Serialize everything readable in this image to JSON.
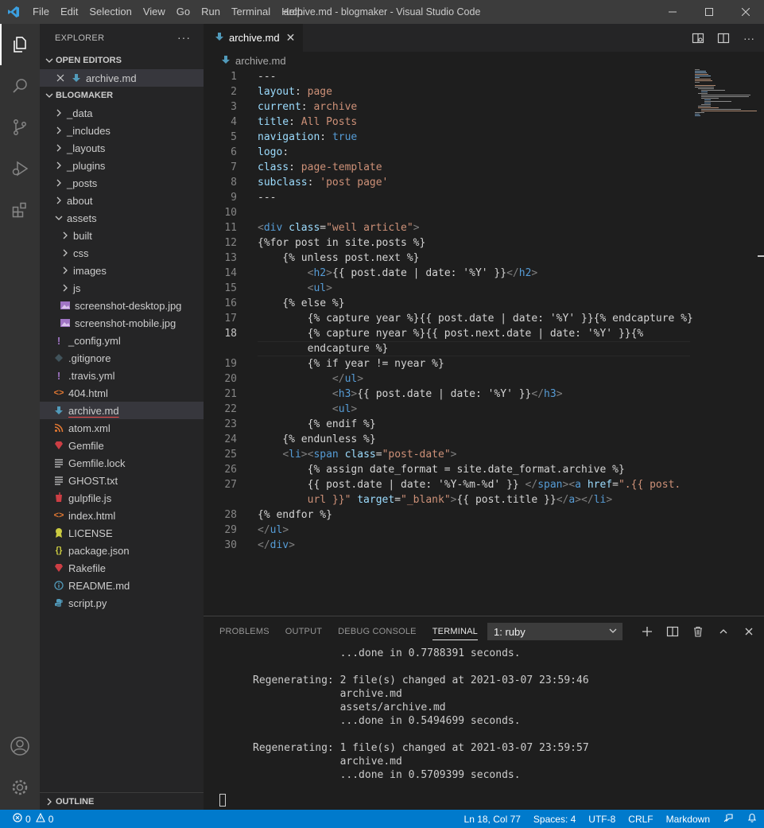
{
  "window": {
    "title": "archive.md - blogmaker - Visual Studio Code",
    "menu": [
      "File",
      "Edit",
      "Selection",
      "View",
      "Go",
      "Run",
      "Terminal",
      "Help"
    ]
  },
  "sidebar": {
    "header": "EXPLORER",
    "open_editors_label": "OPEN EDITORS",
    "open_editors": [
      {
        "name": "archive.md"
      }
    ],
    "project_label": "BLOGMAKER",
    "outline_label": "OUTLINE",
    "tree": [
      {
        "name": "_data",
        "type": "folder",
        "depth": 0
      },
      {
        "name": "_includes",
        "type": "folder",
        "depth": 0
      },
      {
        "name": "_layouts",
        "type": "folder",
        "depth": 0
      },
      {
        "name": "_plugins",
        "type": "folder",
        "depth": 0
      },
      {
        "name": "_posts",
        "type": "folder",
        "depth": 0
      },
      {
        "name": "about",
        "type": "folder",
        "depth": 0
      },
      {
        "name": "assets",
        "type": "folder-open",
        "depth": 0
      },
      {
        "name": "built",
        "type": "folder",
        "depth": 1
      },
      {
        "name": "css",
        "type": "folder",
        "depth": 1
      },
      {
        "name": "images",
        "type": "folder",
        "depth": 1
      },
      {
        "name": "js",
        "type": "folder",
        "depth": 1
      },
      {
        "name": "screenshot-desktop.jpg",
        "type": "image",
        "depth": 1
      },
      {
        "name": "screenshot-mobile.jpg",
        "type": "image",
        "depth": 1
      },
      {
        "name": "_config.yml",
        "type": "yaml",
        "depth": 0
      },
      {
        "name": ".gitignore",
        "type": "git",
        "depth": 0
      },
      {
        "name": ".travis.yml",
        "type": "yaml",
        "depth": 0
      },
      {
        "name": "404.html",
        "type": "html",
        "depth": 0
      },
      {
        "name": "archive.md",
        "type": "markdown",
        "depth": 0
      },
      {
        "name": "atom.xml",
        "type": "rss",
        "depth": 0
      },
      {
        "name": "Gemfile",
        "type": "ruby",
        "depth": 0
      },
      {
        "name": "Gemfile.lock",
        "type": "lines",
        "depth": 0
      },
      {
        "name": "GHOST.txt",
        "type": "lines",
        "depth": 0
      },
      {
        "name": "gulpfile.js",
        "type": "gulp",
        "depth": 0
      },
      {
        "name": "index.html",
        "type": "html",
        "depth": 0
      },
      {
        "name": "LICENSE",
        "type": "license",
        "depth": 0
      },
      {
        "name": "package.json",
        "type": "json",
        "depth": 0
      },
      {
        "name": "Rakefile",
        "type": "ruby",
        "depth": 0
      },
      {
        "name": "README.md",
        "type": "info",
        "depth": 0
      },
      {
        "name": "script.py",
        "type": "python",
        "depth": 0
      }
    ]
  },
  "editor": {
    "tab_label": "archive.md",
    "breadcrumb": "archive.md",
    "lines": [
      {
        "n": "1",
        "html": "<span class=\"p\">---</span>"
      },
      {
        "n": "2",
        "html": "<span class=\"a\">layout</span><span class=\"p\">: </span><span class=\"s\">page</span>"
      },
      {
        "n": "3",
        "html": "<span class=\"a\">current</span><span class=\"p\">: </span><span class=\"s\">archive</span>"
      },
      {
        "n": "4",
        "html": "<span class=\"a\">title</span><span class=\"p\">: </span><span class=\"s\">All Posts</span>"
      },
      {
        "n": "5",
        "html": "<span class=\"a\">navigation</span><span class=\"p\">: </span><span class=\"k\">true</span>"
      },
      {
        "n": "6",
        "html": "<span class=\"a\">logo</span><span class=\"p\">:</span>"
      },
      {
        "n": "7",
        "html": "<span class=\"a\">class</span><span class=\"p\">: </span><span class=\"s\">page-template</span>"
      },
      {
        "n": "8",
        "html": "<span class=\"a\">subclass</span><span class=\"p\">: </span><span class=\"s\">'post page'</span>"
      },
      {
        "n": "9",
        "html": "<span class=\"p\">---</span>"
      },
      {
        "n": "10",
        "html": ""
      },
      {
        "n": "11",
        "html": "<span class=\"t\">&lt;</span><span class=\"k\">div</span> <span class=\"a\">class</span><span class=\"p\">=</span><span class=\"s\">\"well article\"</span><span class=\"t\">&gt;</span>"
      },
      {
        "n": "12",
        "html": "<span class=\"p\">{%for post in site.posts %}</span>"
      },
      {
        "n": "13",
        "html": "<span class=\"p\">    {% unless post.next %}</span>"
      },
      {
        "n": "14",
        "html": "<span class=\"p\">        </span><span class=\"t\">&lt;</span><span class=\"k\">h2</span><span class=\"t\">&gt;</span><span class=\"p\">{{ post.date | date: '%Y' }}</span><span class=\"t\">&lt;/</span><span class=\"k\">h2</span><span class=\"t\">&gt;</span>"
      },
      {
        "n": "15",
        "html": "<span class=\"p\">        </span><span class=\"t\">&lt;</span><span class=\"k\">ul</span><span class=\"t\">&gt;</span>"
      },
      {
        "n": "16",
        "html": "<span class=\"p\">    {% else %}</span>"
      },
      {
        "n": "17",
        "html": "<span class=\"p\">        {% capture year %}{{ post.date | date: '%Y' }}{% endcapture %}</span>"
      },
      {
        "n": "18",
        "html": "<span class=\"p\">        {% capture nyear %}{{ post.next.date | date: '%Y' }}{%</span>"
      },
      {
        "n": "",
        "html": "<span class=\"p\">        endcapture %}</span>"
      },
      {
        "n": "19",
        "html": "<span class=\"p\">        {% if year != nyear %}</span>"
      },
      {
        "n": "20",
        "html": "<span class=\"p\">            </span><span class=\"t\">&lt;/</span><span class=\"k\">ul</span><span class=\"t\">&gt;</span>"
      },
      {
        "n": "21",
        "html": "<span class=\"p\">            </span><span class=\"t\">&lt;</span><span class=\"k\">h3</span><span class=\"t\">&gt;</span><span class=\"p\">{{ post.date | date: '%Y' }}</span><span class=\"t\">&lt;/</span><span class=\"k\">h3</span><span class=\"t\">&gt;</span>"
      },
      {
        "n": "22",
        "html": "<span class=\"p\">            </span><span class=\"t\">&lt;</span><span class=\"k\">ul</span><span class=\"t\">&gt;</span>"
      },
      {
        "n": "23",
        "html": "<span class=\"p\">        {% endif %}</span>"
      },
      {
        "n": "24",
        "html": "<span class=\"p\">    {% endunless %}</span>"
      },
      {
        "n": "25",
        "html": "<span class=\"p\">    </span><span class=\"t\">&lt;</span><span class=\"k\">li</span><span class=\"t\">&gt;&lt;</span><span class=\"k\">span</span> <span class=\"a\">class</span><span class=\"p\">=</span><span class=\"s\">\"post-date\"</span><span class=\"t\">&gt;</span>"
      },
      {
        "n": "26",
        "html": "<span class=\"p\">        {% assign date_format = site.date_format.archive %}</span>"
      },
      {
        "n": "27",
        "html": "<span class=\"p\">        {{ post.date | date: '%Y-%m-%d' }} </span><span class=\"t\">&lt;/</span><span class=\"k\">span</span><span class=\"t\">&gt;&lt;</span><span class=\"k\">a</span> <span class=\"a\">href</span><span class=\"p\">=</span><span class=\"s\">\".{{ post.</span>"
      },
      {
        "n": "",
        "html": "<span class=\"s\">        url }}\"</span> <span class=\"a\">target</span><span class=\"p\">=</span><span class=\"s\">\"_blank\"</span><span class=\"t\">&gt;</span><span class=\"p\">{{ post.title }}</span><span class=\"t\">&lt;/</span><span class=\"k\">a</span><span class=\"t\">&gt;&lt;/</span><span class=\"k\">li</span><span class=\"t\">&gt;</span>"
      },
      {
        "n": "28",
        "html": "<span class=\"p\">{% endfor %}</span>"
      },
      {
        "n": "29",
        "html": "<span class=\"t\">&lt;/</span><span class=\"k\">ul</span><span class=\"t\">&gt;</span>"
      },
      {
        "n": "30",
        "html": "<span class=\"t\">&lt;/</span><span class=\"k\">div</span><span class=\"t\">&gt;</span>"
      }
    ]
  },
  "panel": {
    "tabs": [
      "PROBLEMS",
      "OUTPUT",
      "DEBUG CONSOLE",
      "TERMINAL"
    ],
    "active_tab": "TERMINAL",
    "terminal_select": "1: ruby",
    "terminal_lines": [
      "              ...done in 0.7788391 seconds.",
      "",
      "Regenerating: 2 file(s) changed at 2021-03-07 23:59:46",
      "              archive.md",
      "              assets/archive.md",
      "              ...done in 0.5494699 seconds.",
      "",
      "Regenerating: 1 file(s) changed at 2021-03-07 23:59:57",
      "              archive.md",
      "              ...done in 0.5709399 seconds."
    ]
  },
  "statusbar": {
    "errors": "0",
    "warnings": "0",
    "position": "Ln 18, Col 77",
    "spaces": "Spaces: 4",
    "encoding": "UTF-8",
    "eol": "CRLF",
    "language": "Markdown"
  },
  "colors": {
    "accent": "#007acc",
    "titlebar": "#3c3c3c",
    "activitybar": "#333333",
    "sidebar": "#252526",
    "editor": "#1e1e1e"
  }
}
